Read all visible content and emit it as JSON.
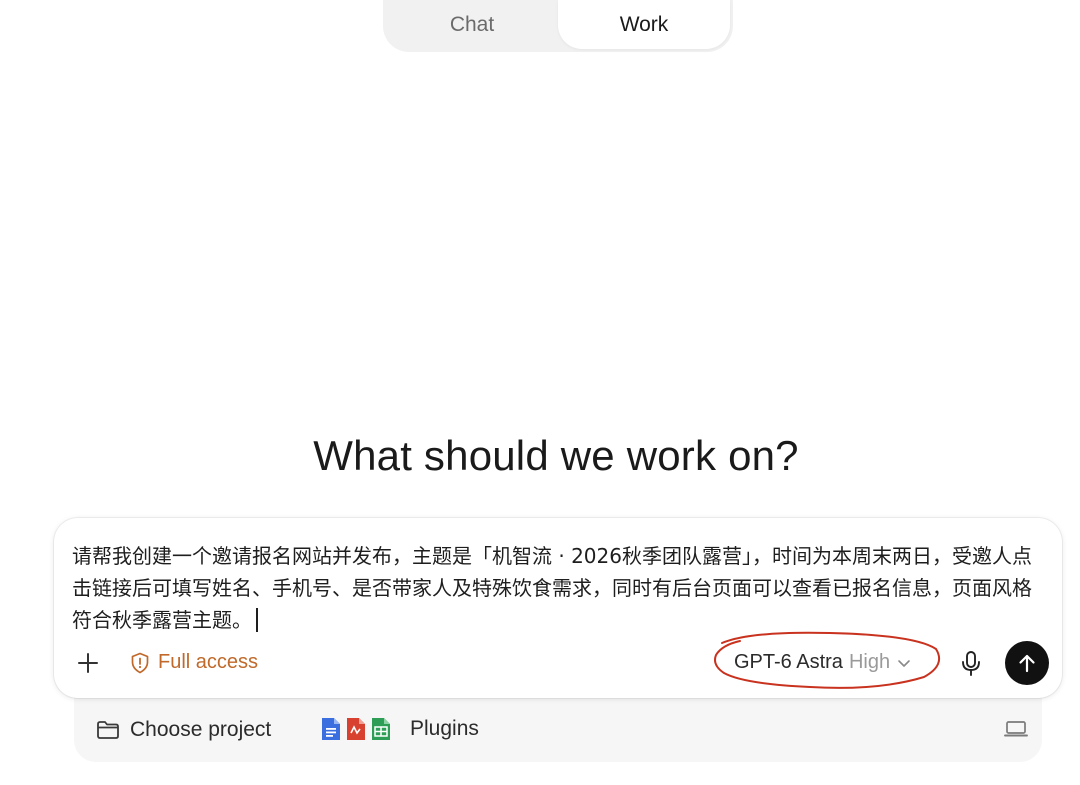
{
  "mode_toggle": {
    "tabs": [
      {
        "label": "Chat"
      },
      {
        "label": "Work"
      }
    ],
    "active": "Work"
  },
  "heading": "What should we work on?",
  "composer": {
    "text": "请帮我创建一个邀请报名网站并发布，主题是「机智流 · 2026秋季团队露营」，时间为本周末两日，受邀人点击链接后可填写姓名、手机号、是否带家人及特殊饮食需求，同时有后台页面可以查看已报名信息，页面风格符合秋季露营主题。",
    "access_label": "Full access",
    "model_name": "GPT-6 Astra",
    "model_effort": "High"
  },
  "subbar": {
    "project_label": "Choose project",
    "plugins_label": "Plugins"
  },
  "colors": {
    "accent_access": "#c0692a",
    "annotation": "#c8321e",
    "send_bg": "#111111"
  }
}
